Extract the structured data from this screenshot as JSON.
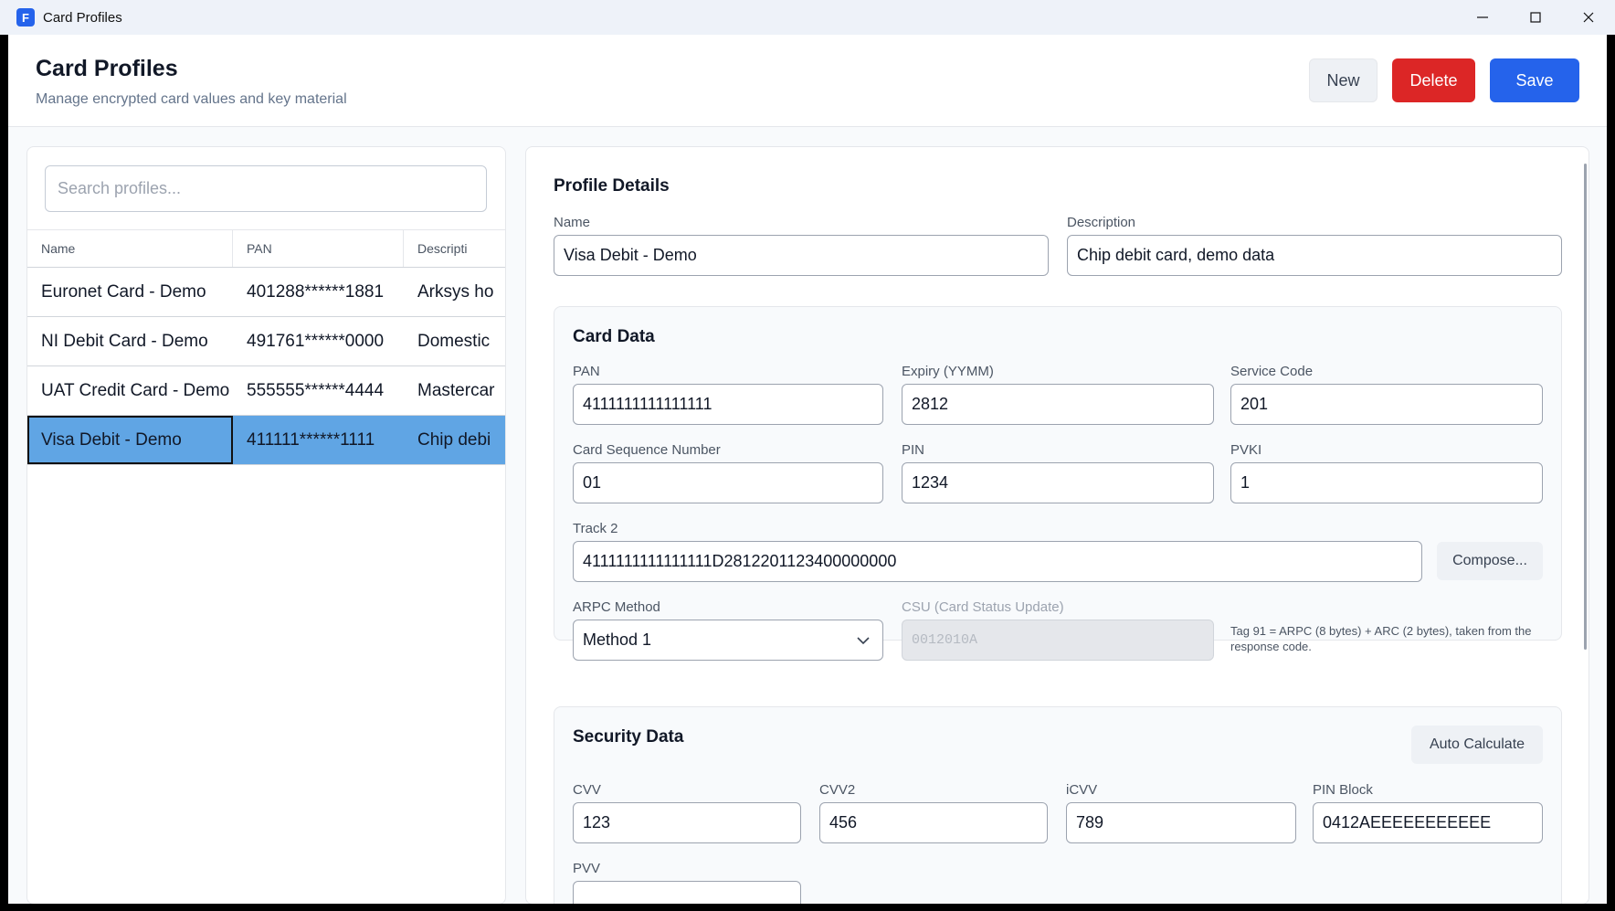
{
  "window": {
    "title": "Card Profiles",
    "icon_letter": "F"
  },
  "header": {
    "title": "Card Profiles",
    "subtitle": "Manage encrypted card values and key material",
    "new_label": "New",
    "delete_label": "Delete",
    "save_label": "Save"
  },
  "list": {
    "search_placeholder": "Search profiles...",
    "columns": [
      "Name",
      "PAN",
      "Descripti"
    ],
    "rows": [
      {
        "name": "Euronet Card - Demo",
        "pan": "401288******1881",
        "desc": "Arksys ho"
      },
      {
        "name": "NI Debit Card - Demo",
        "pan": "491761******0000",
        "desc": "Domestic"
      },
      {
        "name": "UAT Credit Card - Demo",
        "pan": "555555******4444",
        "desc": "Mastercar"
      },
      {
        "name": "Visa Debit - Demo",
        "pan": "411111******1111",
        "desc": "Chip debi"
      }
    ],
    "selected_index": 3
  },
  "details": {
    "title": "Profile Details",
    "name_label": "Name",
    "name_value": "Visa Debit - Demo",
    "description_label": "Description",
    "description_value": "Chip debit card, demo data"
  },
  "card_data": {
    "title": "Card Data",
    "pan_label": "PAN",
    "pan_value": "4111111111111111",
    "expiry_label": "Expiry (YYMM)",
    "expiry_value": "2812",
    "service_code_label": "Service Code",
    "service_code_value": "201",
    "csn_label": "Card Sequence Number",
    "csn_value": "01",
    "pin_label": "PIN",
    "pin_value": "1234",
    "pvki_label": "PVKI",
    "pvki_value": "1",
    "track2_label": "Track 2",
    "track2_value": "4111111111111111D2812201123400000000",
    "compose_label": "Compose...",
    "arpc_label": "ARPC Method",
    "arpc_value": "Method 1",
    "csu_label": "CSU (Card Status Update)",
    "csu_value": "0012010A",
    "hint": "Tag 91 = ARPC (8 bytes) + ARC (2 bytes), taken from the response code."
  },
  "security_data": {
    "title": "Security Data",
    "auto_calc_label": "Auto Calculate",
    "cvv_label": "CVV",
    "cvv_value": "123",
    "cvv2_label": "CVV2",
    "cvv2_value": "456",
    "icvv_label": "iCVV",
    "icvv_value": "789",
    "pin_block_label": "PIN Block",
    "pin_block_value": "0412AEEEEEEEEEEE",
    "pvv_label": "PVV"
  },
  "colors": {
    "accent": "#2563eb",
    "danger": "#dc2626",
    "selection": "#60a5e4"
  }
}
